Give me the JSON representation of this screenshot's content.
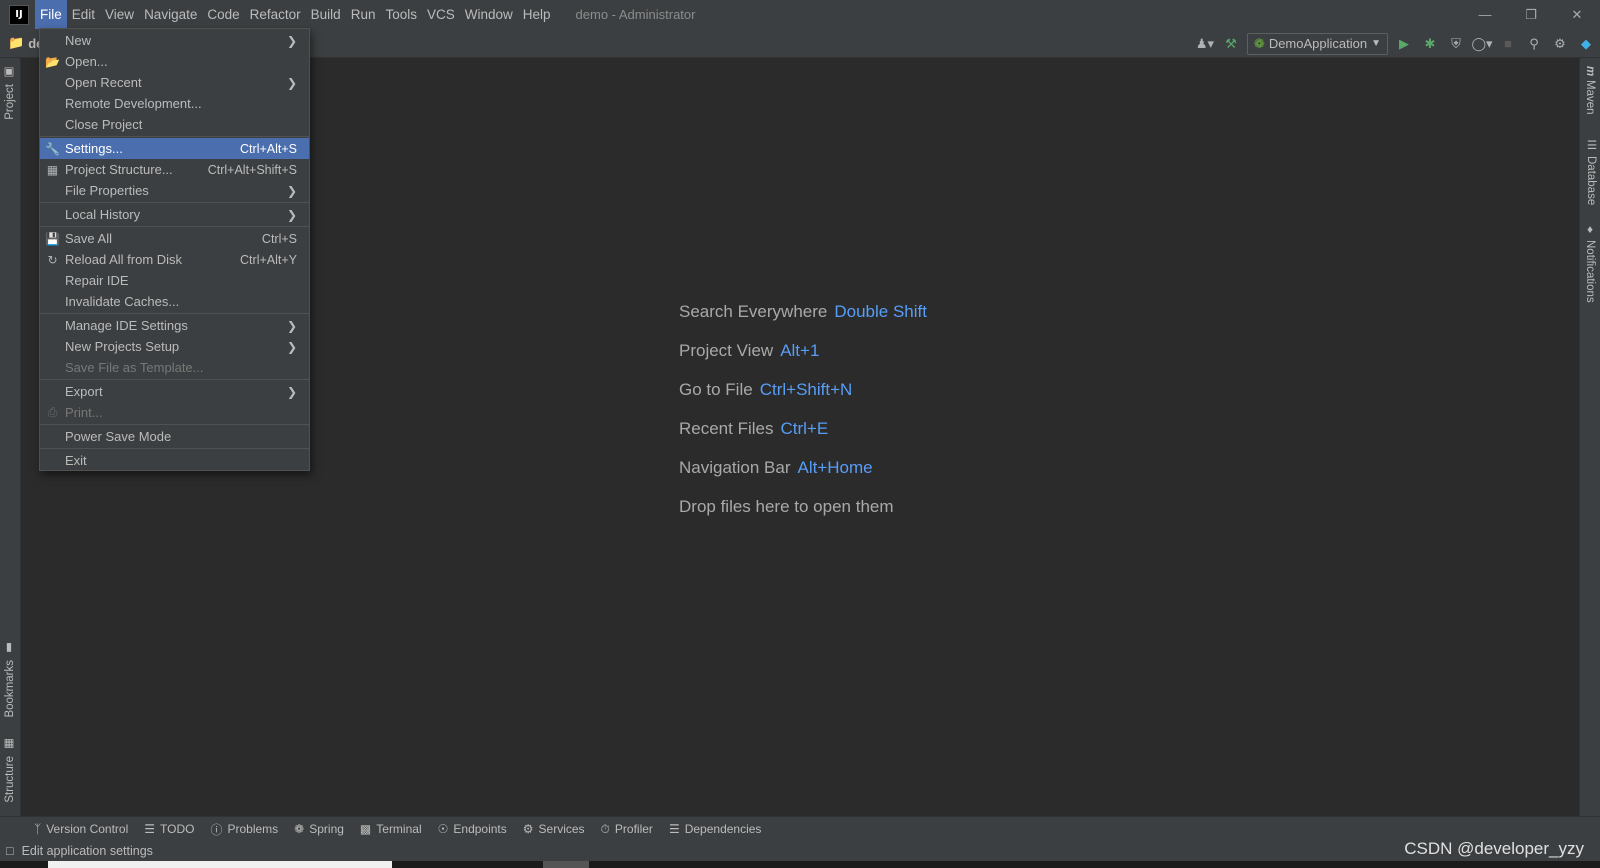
{
  "titlebar": {
    "logo": "IJ",
    "menus": [
      "File",
      "Edit",
      "View",
      "Navigate",
      "Code",
      "Refactor",
      "Build",
      "Run",
      "Tools",
      "VCS",
      "Window",
      "Help"
    ],
    "window_title": "demo - Administrator"
  },
  "toolbar": {
    "project_crumb": "de",
    "run_config": "DemoApplication"
  },
  "left_stripe": {
    "project": "Project",
    "bookmarks": "Bookmarks",
    "structure": "Structure"
  },
  "right_stripe": {
    "maven": "Maven",
    "database": "Database",
    "notifications": "Notifications"
  },
  "file_menu": {
    "items": [
      {
        "label": "New",
        "shortcut": "",
        "submenu": true,
        "icon": ""
      },
      {
        "label": "Open...",
        "shortcut": "",
        "submenu": false,
        "icon": "folder-icon"
      },
      {
        "label": "Open Recent",
        "shortcut": "",
        "submenu": true,
        "icon": ""
      },
      {
        "label": "Remote Development...",
        "shortcut": "",
        "submenu": false,
        "icon": ""
      },
      {
        "label": "Close Project",
        "shortcut": "",
        "submenu": false,
        "icon": ""
      },
      {
        "label": "Settings...",
        "shortcut": "Ctrl+Alt+S",
        "submenu": false,
        "icon": "wrench-icon",
        "selected": true
      },
      {
        "label": "Project Structure...",
        "shortcut": "Ctrl+Alt+Shift+S",
        "submenu": false,
        "icon": "project-structure-icon"
      },
      {
        "label": "File Properties",
        "shortcut": "",
        "submenu": true,
        "icon": ""
      },
      {
        "label": "Local History",
        "shortcut": "",
        "submenu": true,
        "icon": ""
      },
      {
        "label": "Save All",
        "shortcut": "Ctrl+S",
        "submenu": false,
        "icon": "save-icon"
      },
      {
        "label": "Reload All from Disk",
        "shortcut": "Ctrl+Alt+Y",
        "submenu": false,
        "icon": "reload-icon"
      },
      {
        "label": "Repair IDE",
        "shortcut": "",
        "submenu": false,
        "icon": ""
      },
      {
        "label": "Invalidate Caches...",
        "shortcut": "",
        "submenu": false,
        "icon": ""
      },
      {
        "label": "Manage IDE Settings",
        "shortcut": "",
        "submenu": true,
        "icon": ""
      },
      {
        "label": "New Projects Setup",
        "shortcut": "",
        "submenu": true,
        "icon": ""
      },
      {
        "label": "Save File as Template...",
        "shortcut": "",
        "submenu": false,
        "icon": "",
        "disabled": true
      },
      {
        "label": "Export",
        "shortcut": "",
        "submenu": true,
        "icon": ""
      },
      {
        "label": "Print...",
        "shortcut": "",
        "submenu": false,
        "icon": "print-icon",
        "disabled": true
      },
      {
        "label": "Power Save Mode",
        "shortcut": "",
        "submenu": false,
        "icon": ""
      },
      {
        "label": "Exit",
        "shortcut": "",
        "submenu": false,
        "icon": ""
      }
    ]
  },
  "editor_hints": [
    {
      "action": "Search Everywhere",
      "key": "Double Shift"
    },
    {
      "action": "Project View",
      "key": "Alt+1"
    },
    {
      "action": "Go to File",
      "key": "Ctrl+Shift+N"
    },
    {
      "action": "Recent Files",
      "key": "Ctrl+E"
    },
    {
      "action": "Navigation Bar",
      "key": "Alt+Home"
    },
    {
      "action": "Drop files here to open them",
      "key": ""
    }
  ],
  "bottom_tools": [
    "Version Control",
    "TODO",
    "Problems",
    "Spring",
    "Terminal",
    "Endpoints",
    "Services",
    "Profiler",
    "Dependencies"
  ],
  "status": {
    "message": "Edit application settings"
  },
  "watermark": "CSDN @developer_yzy",
  "colors": {
    "accent": "#4b6eaf",
    "hint_key": "#589df6",
    "background": "#2b2b2b",
    "panel": "#3c3f41"
  }
}
